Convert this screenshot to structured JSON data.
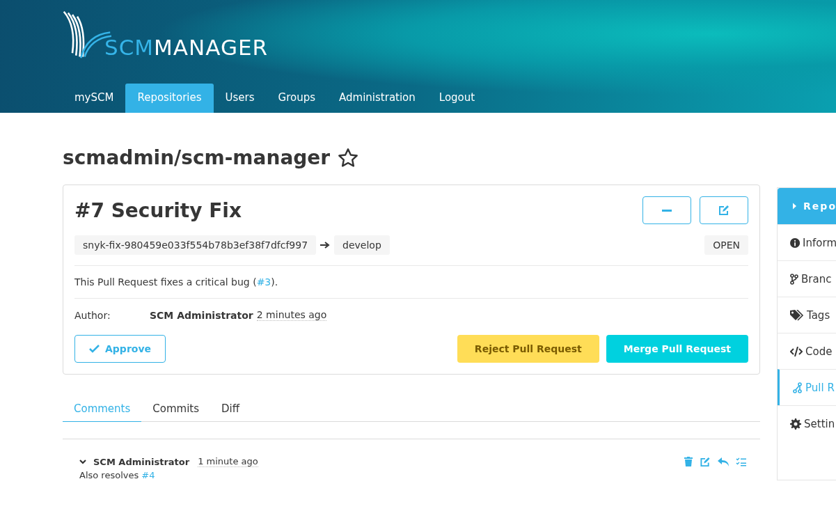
{
  "header": {
    "logo": {
      "part_1": "SCM",
      "part_2": "MANAGER"
    },
    "nav": [
      {
        "label": "mySCM",
        "selected": false
      },
      {
        "label": "Repositories",
        "selected": true
      },
      {
        "label": "Users",
        "selected": false
      },
      {
        "label": "Groups",
        "selected": false
      },
      {
        "label": "Administration",
        "selected": false
      },
      {
        "label": "Logout",
        "selected": false
      }
    ]
  },
  "repository": {
    "title": "scmadmin/scm-manager",
    "starred": false
  },
  "pull_request": {
    "title": "#7 Security Fix",
    "source_branch": "snyk-fix-980459e033f554b78b3ef38f7dfcf997",
    "target_branch": "develop",
    "status": "OPEN",
    "description": {
      "before": "This Pull Request fixes a critical bug (",
      "link": "#3",
      "after": ")."
    },
    "author_label": "Author:",
    "author": "SCM Administrator",
    "time": "2 minutes ago",
    "buttons": [
      {
        "label": "Approve",
        "kind": "approve"
      },
      {
        "label": "Reject Pull Request",
        "kind": "reject"
      },
      {
        "label": "Merge Pull Request",
        "kind": "merge"
      }
    ]
  },
  "tabs": [
    {
      "label": "Comments",
      "selected": true
    },
    {
      "label": "Commits",
      "selected": false
    },
    {
      "label": "Diff",
      "selected": false
    }
  ],
  "comment": {
    "author": "SCM Administrator",
    "time": "1 minute ago",
    "text": "Also resolves ",
    "link": "#4",
    "expanded": true
  },
  "sidebar": {
    "heading": "Repo",
    "items": [
      {
        "label": "Inform",
        "kind": "info",
        "selected": false
      },
      {
        "label": "Branc",
        "kind": "branch",
        "selected": false
      },
      {
        "label": "Tags",
        "kind": "tags",
        "selected": false
      },
      {
        "label": "Code",
        "kind": "code",
        "selected": false
      },
      {
        "label": "Pull R",
        "kind": "pull",
        "selected": true
      },
      {
        "label": "Settin",
        "kind": "settings",
        "selected": false
      }
    ]
  }
}
